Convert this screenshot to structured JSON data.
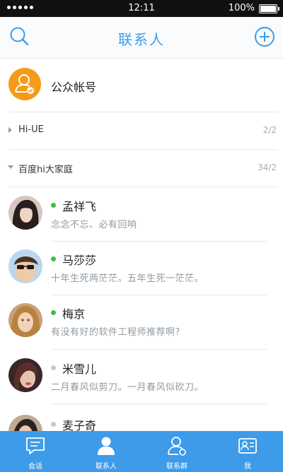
{
  "status_bar": {
    "time": "12:11",
    "battery": "100%"
  },
  "header": {
    "title": "联系人"
  },
  "official_account": {
    "label": "公众帐号"
  },
  "groups": [
    {
      "name": "Hi-UE",
      "count": "2/2"
    },
    {
      "name": "百度hi大家庭",
      "count": "34/2"
    }
  ],
  "contacts": [
    {
      "name": "孟祥飞",
      "signature": "念念不忘、必有回响",
      "status": "online"
    },
    {
      "name": "马莎莎",
      "signature": "十年生死两茫茫。五年生死一茫茫。",
      "status": "online"
    },
    {
      "name": "梅京",
      "signature": "有没有好的软件工程师推荐啊?",
      "status": "online"
    },
    {
      "name": "米雪儿",
      "signature": "二月春风似剪刀。一月春风似砍刀。",
      "status": "offline"
    },
    {
      "name": "麦子奇",
      "signature": "",
      "status": "offline"
    }
  ],
  "tabs": [
    {
      "label": "会话"
    },
    {
      "label": "联系人"
    },
    {
      "label": "联系群"
    },
    {
      "label": "我"
    }
  ],
  "colors": {
    "accent": "#3d9be9",
    "online": "#3fbf3f",
    "offline": "#c8c8c8",
    "official": "#f59b1a"
  }
}
